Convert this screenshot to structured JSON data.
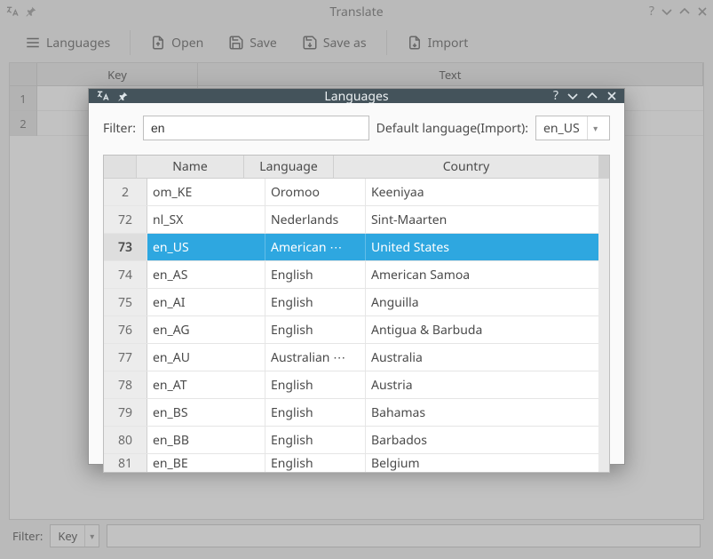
{
  "main": {
    "title": "Translate",
    "toolbar": {
      "languages": "Languages",
      "open": "Open",
      "save": "Save",
      "saveas": "Save as",
      "import": "Import"
    },
    "columns": {
      "key": "Key",
      "text": "Text"
    },
    "rows": [
      "1",
      "2"
    ],
    "filter_label": "Filter:",
    "filter_type": "Key"
  },
  "dialog": {
    "title": "Languages",
    "filter_label": "Filter:",
    "filter_value": "en",
    "default_lang_label": "Default language(Import):",
    "default_lang_value": "en_US",
    "columns": {
      "name": "Name",
      "language": "Language",
      "country": "Country"
    },
    "rows": [
      {
        "n": "2",
        "name": "om_KE",
        "lang": "Oromoo",
        "country": "Keeniyaa",
        "selected": false
      },
      {
        "n": "72",
        "name": "nl_SX",
        "lang": "Nederlands",
        "country": "Sint-Maarten",
        "selected": false
      },
      {
        "n": "73",
        "name": "en_US",
        "lang": "American ⋯",
        "country": "United States",
        "selected": true
      },
      {
        "n": "74",
        "name": "en_AS",
        "lang": "English",
        "country": "American Samoa",
        "selected": false
      },
      {
        "n": "75",
        "name": "en_AI",
        "lang": "English",
        "country": "Anguilla",
        "selected": false
      },
      {
        "n": "76",
        "name": "en_AG",
        "lang": "English",
        "country": "Antigua & Barbuda",
        "selected": false
      },
      {
        "n": "77",
        "name": "en_AU",
        "lang": "Australian ⋯",
        "country": "Australia",
        "selected": false
      },
      {
        "n": "78",
        "name": "en_AT",
        "lang": "English",
        "country": "Austria",
        "selected": false
      },
      {
        "n": "79",
        "name": "en_BS",
        "lang": "English",
        "country": "Bahamas",
        "selected": false
      },
      {
        "n": "80",
        "name": "en_BB",
        "lang": "English",
        "country": "Barbados",
        "selected": false
      },
      {
        "n": "81",
        "name": "en_BE",
        "lang": "English",
        "country": "Belgium",
        "selected": false
      }
    ]
  }
}
